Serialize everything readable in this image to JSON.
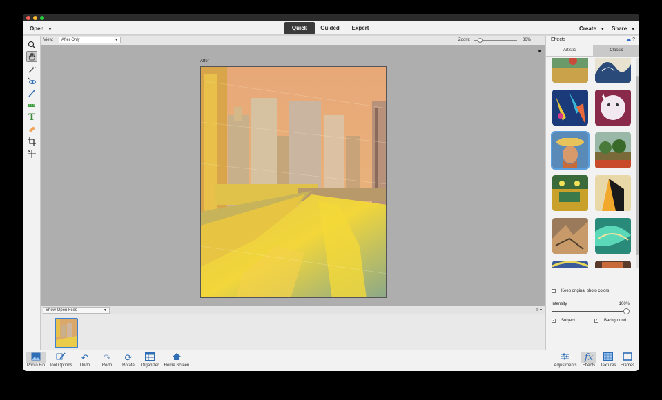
{
  "menubar": {
    "open_label": "Open",
    "modes": [
      "Quick",
      "Guided",
      "Expert"
    ],
    "active_mode": "Quick",
    "create_label": "Create",
    "share_label": "Share"
  },
  "options_bar": {
    "view_label": "View:",
    "view_value": "After Only",
    "zoom_label": "Zoom:",
    "zoom_value": "36%",
    "zoom_level": 0.1
  },
  "canvas": {
    "after_label": "After"
  },
  "photo_bin": {
    "show_files_value": "Show Open Files"
  },
  "effects_panel": {
    "title": "Effects",
    "tabs": [
      "Artistic",
      "Classic"
    ],
    "active_tab": "Artistic",
    "keep_colors_label": "Keep original photo colors",
    "keep_colors_checked": false,
    "intensity_label": "Intensity",
    "intensity_value": "100%",
    "subject_label": "Subject",
    "subject_checked": true,
    "background_label": "Background",
    "background_checked": true
  },
  "bottom_left": [
    {
      "label": "Photo Bin",
      "icon": "photo-bin-icon"
    },
    {
      "label": "Tool Options",
      "icon": "tool-options-icon"
    },
    {
      "label": "Undo",
      "icon": "undo-icon"
    },
    {
      "label": "Redo",
      "icon": "redo-icon"
    },
    {
      "label": "Rotate",
      "icon": "rotate-icon"
    },
    {
      "label": "Organizer",
      "icon": "organizer-icon"
    },
    {
      "label": "Home Screen",
      "icon": "home-icon"
    }
  ],
  "bottom_right": [
    {
      "label": "Adjustments",
      "icon": "adjustments-icon"
    },
    {
      "label": "Effects",
      "icon": "fx-icon"
    },
    {
      "label": "Textures",
      "icon": "textures-icon"
    },
    {
      "label": "Frames",
      "icon": "frames-icon"
    }
  ],
  "colors": {
    "accent": "#3d7fd0",
    "dark_tab": "#3a3a3a"
  }
}
